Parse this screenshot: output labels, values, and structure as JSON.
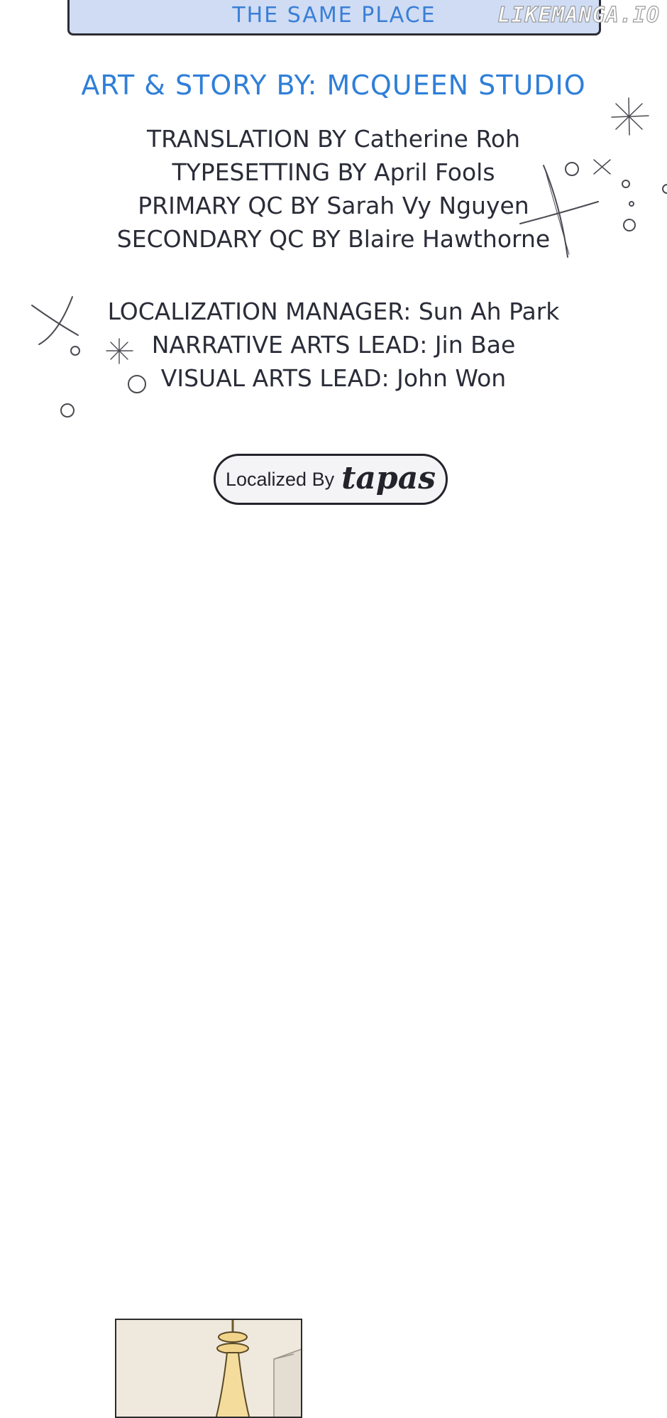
{
  "header": {
    "title": "THE SAME PLACE",
    "watermark": "LIKEMANGA.IO"
  },
  "credits": {
    "art_story": "ART & STORY BY: MCQUEEN STUDIO",
    "team": [
      "TRANSLATION BY Catherine Roh",
      "TYPESETTING BY April Fools",
      "PRIMARY QC BY Sarah Vy Nguyen",
      "SECONDARY QC BY Blaire Hawthorne"
    ],
    "leads": [
      "LOCALIZATION MANAGER: Sun Ah Park",
      "NARRATIVE ARTS LEAD: Jin Bae",
      "VISUAL ARTS LEAD: John Won"
    ]
  },
  "badge": {
    "prefix": "Localized By",
    "brand": "tapas"
  },
  "colors": {
    "title_box": "#cfdcf4",
    "accent_blue": "#2f7fd8",
    "text_dark": "#2a2c38"
  }
}
